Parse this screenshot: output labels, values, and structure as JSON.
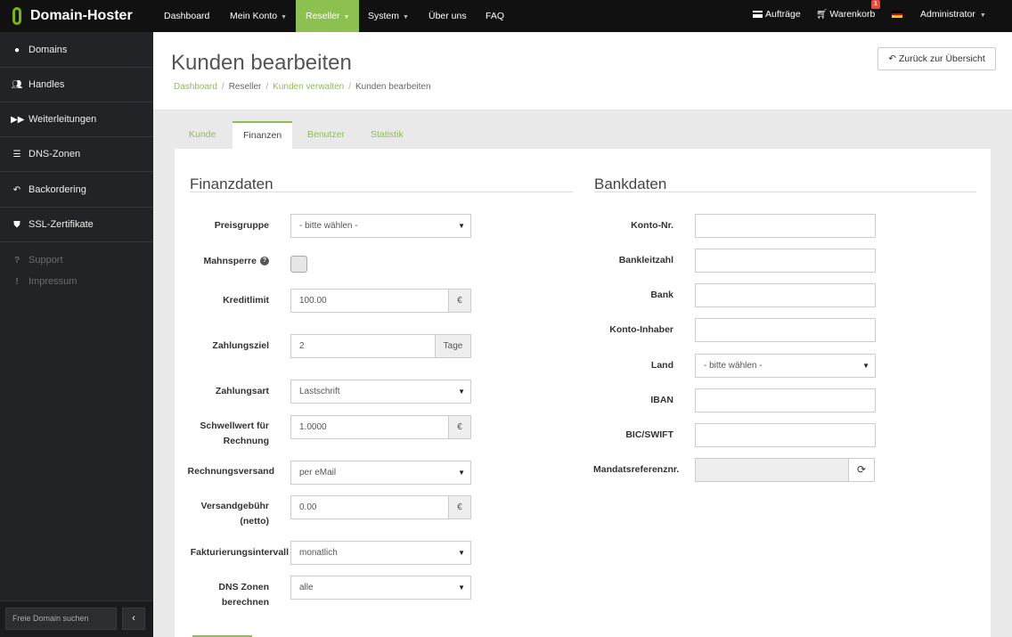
{
  "app": {
    "name": "Domain-Hoster"
  },
  "topnav": {
    "items": [
      {
        "label": "Dashboard",
        "dropdown": false
      },
      {
        "label": "Mein Konto",
        "dropdown": true
      },
      {
        "label": "Reseller",
        "dropdown": true,
        "active": true
      },
      {
        "label": "System",
        "dropdown": true
      },
      {
        "label": "Über uns",
        "dropdown": false
      },
      {
        "label": "FAQ",
        "dropdown": false
      }
    ],
    "orders_label": "Aufträge",
    "cart_label": "Warenkorb",
    "cart_count": "1",
    "user_label": "Administrator",
    "language_flag": "de-flag-icon"
  },
  "sidebar": {
    "items": [
      {
        "label": "Domains",
        "icon": "globe-icon"
      },
      {
        "label": "Handles",
        "icon": "users-icon"
      },
      {
        "label": "Weiterleitungen",
        "icon": "forward-icon"
      },
      {
        "label": "DNS-Zonen",
        "icon": "server-icon"
      },
      {
        "label": "Backordering",
        "icon": "reply-icon"
      },
      {
        "label": "SSL-Zertifikate",
        "icon": "shield-icon"
      }
    ],
    "secondary": [
      {
        "label": "Support",
        "icon": "question-icon"
      },
      {
        "label": "Impressum",
        "icon": "exclamation-icon"
      }
    ],
    "search_placeholder": "Freie Domain suchen"
  },
  "header": {
    "title": "Kunden bearbeiten",
    "breadcrumb": [
      "Dashboard",
      "Reseller",
      "Kunden verwalten",
      "Kunden bearbeiten"
    ],
    "back_button": "Zurück zur Übersicht"
  },
  "tabs": [
    {
      "label": "Kunde",
      "active": false
    },
    {
      "label": "Finanzen",
      "active": true
    },
    {
      "label": "Benutzer",
      "active": false
    },
    {
      "label": "Statistik",
      "active": false
    }
  ],
  "finanzdaten": {
    "title": "Finanzdaten",
    "preisgruppe": {
      "label": "Preisgruppe",
      "value": "- bitte wählen -"
    },
    "mahnsperre": {
      "label": "Mahnsperre",
      "checked": false
    },
    "kreditlimit": {
      "label": "Kreditlimit",
      "value": "100.00",
      "addon": "€"
    },
    "zahlungsziel": {
      "label": "Zahlungsziel",
      "value": "2",
      "addon": "Tage"
    },
    "zahlungsart": {
      "label": "Zahlungsart",
      "value": "Lastschrift"
    },
    "schwellwert": {
      "label_line1": "Schwellwert für",
      "label_line2": "Rechnung",
      "value": "1.0000",
      "addon": "€"
    },
    "rechnungsversand": {
      "label": "Rechnungsversand",
      "value": "per eMail"
    },
    "versandgebuehr": {
      "label_line1": "Versandgebühr",
      "label_line2": "(netto)",
      "value": "0.00",
      "addon": "€"
    },
    "fakturierungsintervall": {
      "label": "Fakturierungsintervall",
      "value": "monatlich"
    },
    "dns_zonen": {
      "label_line1": "DNS Zonen",
      "label_line2": "berechnen",
      "value": "alle"
    }
  },
  "bankdaten": {
    "title": "Bankdaten",
    "konto_nr": {
      "label": "Konto-Nr.",
      "value": ""
    },
    "bankleitzahl": {
      "label": "Bankleitzahl",
      "value": ""
    },
    "bank": {
      "label": "Bank",
      "value": ""
    },
    "konto_inhaber": {
      "label": "Konto-Inhaber",
      "value": ""
    },
    "land": {
      "label": "Land",
      "value": "- bitte wählen -"
    },
    "iban": {
      "label": "IBAN",
      "value": ""
    },
    "bic": {
      "label": "BIC/SWIFT",
      "value": ""
    },
    "mandatsreferenz": {
      "label": "Mandatsreferenznr.",
      "value": "",
      "disabled": true
    }
  },
  "colors": {
    "accent": "#8cc152",
    "topbar": "#111111",
    "sidebar": "#222326",
    "badge": "#e74c3c"
  }
}
